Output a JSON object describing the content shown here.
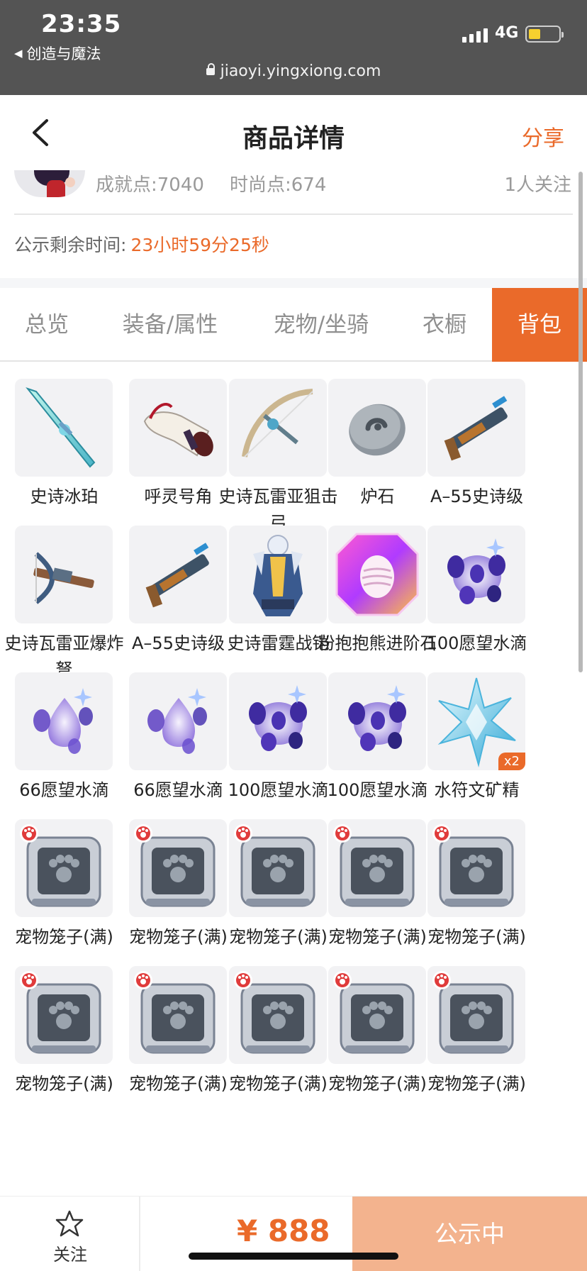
{
  "status_bar": {
    "time": "23:35",
    "back_app": "创造与魔法",
    "network": "4G",
    "url": "jiaoyi.yingxiong.com",
    "battery_level": 0.4
  },
  "nav": {
    "title": "商品详情",
    "share": "分享"
  },
  "summary": {
    "achievement": "成就点:7040",
    "fashion": "时尚点:674",
    "followers": "1人关注",
    "countdown_label": "公示剩余时间:",
    "countdown_value": "23小时59分25秒"
  },
  "tabs": [
    {
      "label": "总览",
      "active": false
    },
    {
      "label": "装备/属性",
      "active": false
    },
    {
      "label": "宠物/坐骑",
      "active": false
    },
    {
      "label": "衣橱",
      "active": false
    },
    {
      "label": "背包",
      "active": true
    }
  ],
  "items": [
    {
      "name": "史诗冰珀",
      "icon": "ice-spear-icon"
    },
    {
      "name": "呼灵号角",
      "icon": "horn-icon"
    },
    {
      "name": "史诗瓦雷亚狙击弓",
      "icon": "bow-icon"
    },
    {
      "name": "炉石",
      "icon": "hearthstone-icon"
    },
    {
      "name": "A–55史诗级",
      "icon": "gun-icon"
    },
    {
      "name": "史诗瓦雷亚爆炸弩",
      "icon": "crossbow-icon"
    },
    {
      "name": "A–55史诗级",
      "icon": "gun-icon"
    },
    {
      "name": "史诗雷霆战铠",
      "icon": "armor-icon"
    },
    {
      "name": "粉抱抱熊进阶石",
      "icon": "egg-gem-icon"
    },
    {
      "name": "100愿望水滴",
      "icon": "wish-drops-icon"
    },
    {
      "name": "66愿望水滴",
      "icon": "wish-drop-icon"
    },
    {
      "name": "66愿望水滴",
      "icon": "wish-drop-icon"
    },
    {
      "name": "100愿望水滴",
      "icon": "wish-drops-icon"
    },
    {
      "name": "100愿望水滴",
      "icon": "wish-drops-icon"
    },
    {
      "name": "水符文矿精",
      "icon": "crystal-icon",
      "qty": "x2"
    },
    {
      "name": "宠物笼子(满)",
      "icon": "pet-cage-icon"
    },
    {
      "name": "宠物笼子(满)",
      "icon": "pet-cage-icon"
    },
    {
      "name": "宠物笼子(满)",
      "icon": "pet-cage-icon"
    },
    {
      "name": "宠物笼子(满)",
      "icon": "pet-cage-icon"
    },
    {
      "name": "宠物笼子(满)",
      "icon": "pet-cage-icon"
    },
    {
      "name": "宠物笼子(满)",
      "icon": "pet-cage-icon"
    },
    {
      "name": "宠物笼子(满)",
      "icon": "pet-cage-icon"
    },
    {
      "name": "宠物笼子(满)",
      "icon": "pet-cage-icon"
    },
    {
      "name": "宠物笼子(满)",
      "icon": "pet-cage-icon"
    },
    {
      "name": "宠物笼子(满)",
      "icon": "pet-cage-icon"
    }
  ],
  "bottom": {
    "follow_label": "关注",
    "price": "¥ 888",
    "status_label": "公示中"
  },
  "colors": {
    "accent": "#ea6a2a",
    "status_button": "#f3b38e",
    "status_bar_bg": "#545454"
  }
}
